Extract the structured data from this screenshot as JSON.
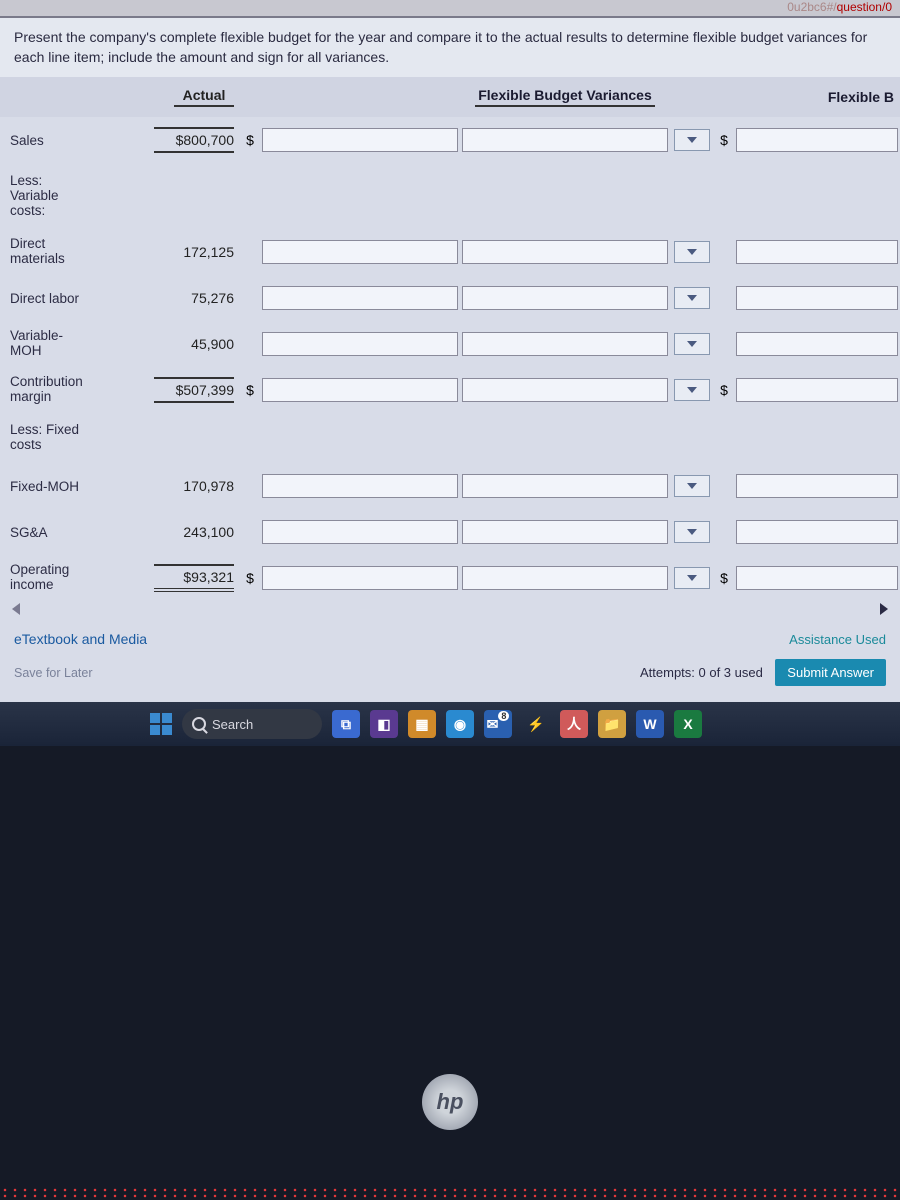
{
  "url_fragment_gray": "0u2bc6#/",
  "url_fragment_red": "question/0",
  "instructions": "Present the company's complete flexible budget for the year and compare it to the actual results to determine flexible budget variances for each line item; include the amount and sign for all variances.",
  "headers": {
    "actual": "Actual",
    "fbv": "Flexible Budget Variances",
    "flexb": "Flexible B"
  },
  "rows": {
    "sales": {
      "label": "Sales",
      "actual": "$800,700",
      "dollar": "$",
      "show_inputs": true,
      "show_drop": true,
      "d2": "$",
      "flex_in": true,
      "lineType": "single"
    },
    "less1": {
      "label": "Less: Variable costs:",
      "actual": "",
      "dollar": "",
      "show_inputs": false,
      "show_drop": false,
      "d2": "",
      "flex_in": false
    },
    "dmat": {
      "label": "Direct materials",
      "actual": "172,125",
      "dollar": "",
      "show_inputs": true,
      "show_drop": true,
      "d2": "",
      "flex_in": true
    },
    "dlab": {
      "label": "Direct labor",
      "actual": "75,276",
      "dollar": "",
      "show_inputs": true,
      "show_drop": true,
      "d2": "",
      "flex_in": true
    },
    "vmoh": {
      "label": "Variable-MOH",
      "actual": "45,900",
      "dollar": "",
      "show_inputs": true,
      "show_drop": true,
      "d2": "",
      "flex_in": true
    },
    "cmarg": {
      "label": "Contribution margin",
      "actual": "$507,399",
      "dollar": "$",
      "show_inputs": true,
      "show_drop": true,
      "d2": "$",
      "flex_in": true,
      "lineType": "single"
    },
    "less2": {
      "label": "Less: Fixed costs",
      "actual": "",
      "dollar": "",
      "show_inputs": false,
      "show_drop": false,
      "d2": "",
      "flex_in": false
    },
    "fmoh": {
      "label": "Fixed-MOH",
      "actual": "170,978",
      "dollar": "",
      "show_inputs": true,
      "show_drop": true,
      "d2": "",
      "flex_in": true
    },
    "sga": {
      "label": "SG&A",
      "actual": "243,100",
      "dollar": "",
      "show_inputs": true,
      "show_drop": true,
      "d2": "",
      "flex_in": true
    },
    "opin": {
      "label": "Operating income",
      "actual": "$93,321",
      "dollar": "$",
      "show_inputs": true,
      "show_drop": true,
      "d2": "$",
      "flex_in": true,
      "lineType": "double"
    }
  },
  "row_order": [
    "sales",
    "less1",
    "dmat",
    "dlab",
    "vmoh",
    "cmarg",
    "less2",
    "fmoh",
    "sga",
    "opin"
  ],
  "links": {
    "etextbook": "eTextbook and Media",
    "assistance": "Assistance Used",
    "save": "Save for Later"
  },
  "submit": {
    "attempts": "Attempts: 0 of 3 used",
    "button": "Submit Answer"
  },
  "taskbar": {
    "search": "Search"
  },
  "hp": "hp"
}
